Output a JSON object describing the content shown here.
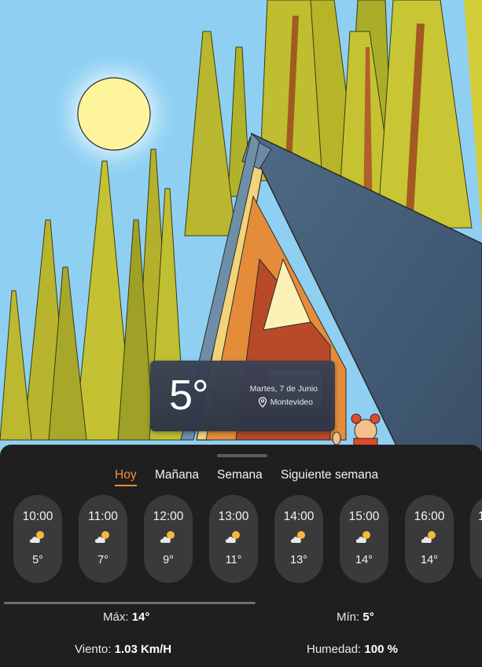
{
  "current": {
    "temperature": "5°",
    "date": "Martes, 7 de Junio",
    "location": "Montevideo"
  },
  "tabs": [
    {
      "label": "Hoy",
      "active": true
    },
    {
      "label": "Mañana",
      "active": false
    },
    {
      "label": "Semana",
      "active": false
    },
    {
      "label": "Siguiente semana",
      "active": false
    }
  ],
  "hourly": [
    {
      "time": "10:00",
      "icon": "partly-cloudy-icon",
      "temp": "5°"
    },
    {
      "time": "11:00",
      "icon": "partly-cloudy-icon",
      "temp": "7°"
    },
    {
      "time": "12:00",
      "icon": "partly-cloudy-icon",
      "temp": "9°"
    },
    {
      "time": "13:00",
      "icon": "partly-cloudy-icon",
      "temp": "11°"
    },
    {
      "time": "14:00",
      "icon": "partly-cloudy-icon",
      "temp": "13°"
    },
    {
      "time": "15:00",
      "icon": "partly-cloudy-icon",
      "temp": "14°"
    },
    {
      "time": "16:00",
      "icon": "partly-cloudy-icon",
      "temp": "14°"
    },
    {
      "time": "1",
      "icon": "partly-cloudy-icon",
      "temp": ""
    }
  ],
  "stats": {
    "max_label": "Máx:",
    "max_value": "14°",
    "min_label": "Mín:",
    "min_value": "5°",
    "wind_label": "Viento:",
    "wind_value": "1.03 Km/H",
    "humidity_label": "Humedad:",
    "humidity_value": "100 %"
  },
  "colors": {
    "accent": "#ff8c3a",
    "panel": "#1f1f1f",
    "pill": "#3a3a3a",
    "sky": "#8fd0f2"
  }
}
